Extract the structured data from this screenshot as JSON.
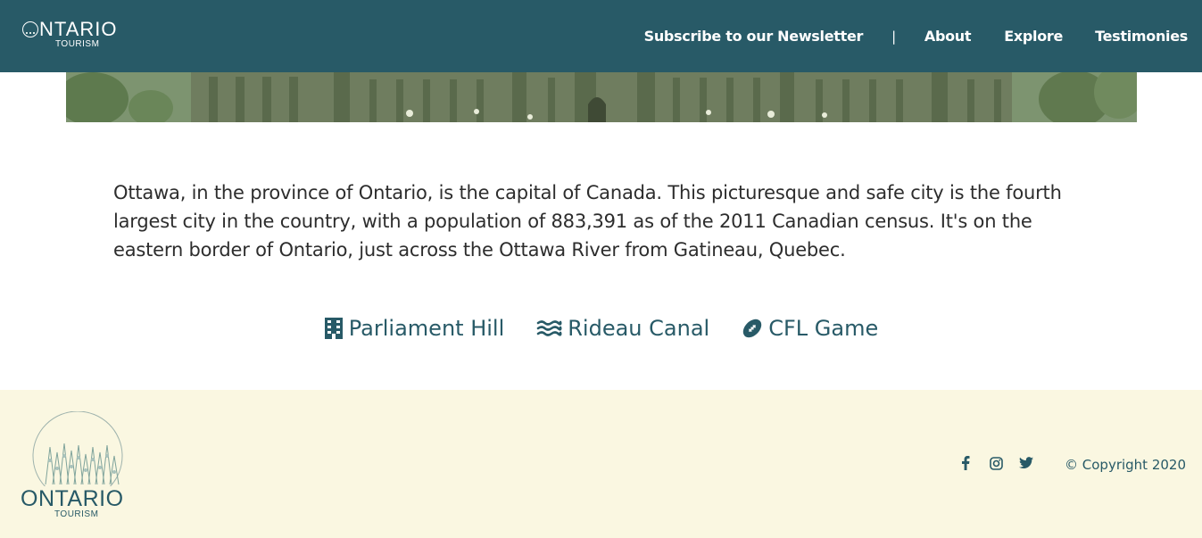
{
  "brand": {
    "name": "ONTARIO",
    "sub": "TOURISM",
    "color": "#285a67"
  },
  "nav": {
    "newsletter": "Subscribe to our Newsletter",
    "separator": "|",
    "about": "About",
    "explore": "Explore",
    "testimonies": "Testimonies"
  },
  "hero": {
    "image": "parliament-buildings-photo"
  },
  "intro": {
    "text": "Ottawa, in the province of Ontario, is the capital of Canada. This picturesque and safe city is the fourth largest city in the country, with a population of 883,391 as of the 2011 Canadian census. It's on the eastern border of Ontario, just across the Ottawa River from Gatineau, Quebec."
  },
  "attractions": [
    {
      "icon": "building-icon",
      "label": "Parliament Hill"
    },
    {
      "icon": "water-icon",
      "label": "Rideau Canal"
    },
    {
      "icon": "football-icon",
      "label": "CFL Game"
    }
  ],
  "footer": {
    "brand": "ONTARIO",
    "sub": "TOURISM",
    "social": [
      "facebook-icon",
      "instagram-icon",
      "twitter-icon"
    ],
    "copyright": "© Copyright 2020",
    "background": "#faf7e1"
  }
}
